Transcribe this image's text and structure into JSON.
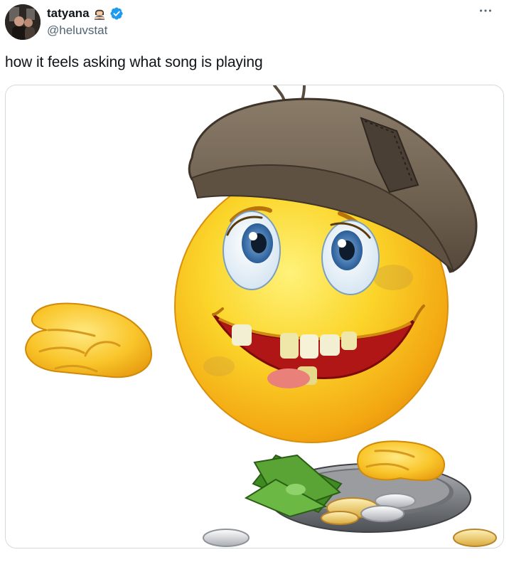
{
  "author": {
    "display_name": "tatyana",
    "handle": "@heluvstat",
    "name_emoji_icon": "crossed-arms-person-icon",
    "verified_icon": "verified-badge-icon",
    "verified_color": "#1d9bf0"
  },
  "tweet": {
    "text": "how it feels asking what song is playing"
  },
  "menu": {
    "icon": "more-horizontal-icon"
  },
  "media": {
    "type": "image",
    "icons": [
      "beggar-emoji-face",
      "open-hand",
      "coin-plate",
      "cash-bills",
      "coins"
    ],
    "colors": {
      "face": "#f7c51e",
      "hat": "#6f6253",
      "plate": "#8a8c90",
      "money": "#4f9d2e"
    }
  }
}
